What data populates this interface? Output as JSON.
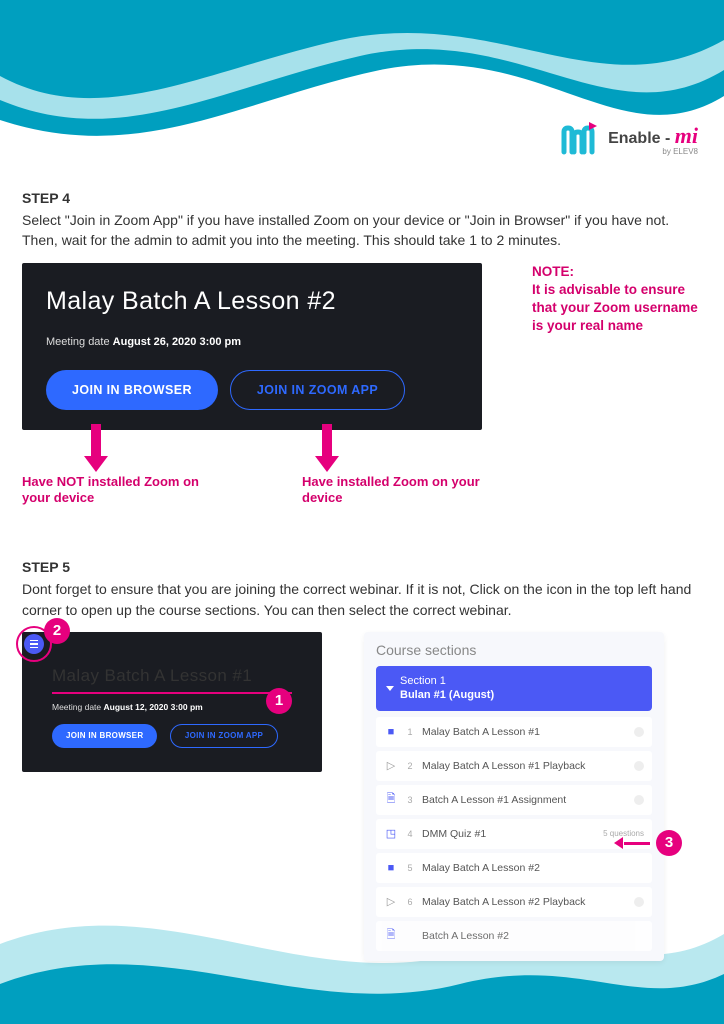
{
  "logo": {
    "brand_prefix": "Enable - ",
    "brand_mi": "mi",
    "byline": "by ELEV8"
  },
  "step4": {
    "heading": "STEP 4",
    "body_line1": "Select \"Join in Zoom App\" if you have installed Zoom on your device or \"Join in Browser\" if you have not.",
    "body_line2": "Then, wait for the admin to admit you into the meeting. This should take 1 to 2 minutes.",
    "zoom_title": "Malay Batch A Lesson #2",
    "zoom_date_label": "Meeting date ",
    "zoom_date_value": "August 26, 2020 3:00 pm",
    "btn_browser": "JOIN IN BROWSER",
    "btn_zoom_app": "JOIN IN ZOOM APP",
    "note_title": "NOTE:",
    "note_body": "It is advisable to ensure that your Zoom username is your real name",
    "annot_not_installed": "Have NOT installed Zoom on your device",
    "annot_installed": "Have installed Zoom on your device"
  },
  "step5": {
    "heading": "STEP 5",
    "body": "Dont forget to ensure that you are joining the correct webinar. If it is not, Click on the icon in the top left hand corner to open up the course sections. You can then select the correct webinar.",
    "mini_title": "Malay Batch A Lesson #1",
    "mini_date_label": "Meeting date ",
    "mini_date_value": "August 12, 2020 3:00 pm",
    "btn_browser": "JOIN IN BROWSER",
    "btn_zoom_app": "JOIN IN ZOOM APP",
    "num1": "1",
    "num2": "2",
    "num3": "3",
    "course_panel_title": "Course sections",
    "section_title_line1": "Section 1",
    "section_title_line2": "Bulan #1 (August)",
    "items": [
      {
        "icon": "video",
        "idx": "1",
        "label": "Malay Batch A Lesson #1"
      },
      {
        "icon": "play",
        "idx": "2",
        "label": "Malay Batch A Lesson #1 Playback"
      },
      {
        "icon": "doc",
        "idx": "3",
        "label": "Batch A Lesson #1 Assignment"
      },
      {
        "icon": "quiz",
        "idx": "4",
        "label": "DMM Quiz #1",
        "meta": "5 questions"
      },
      {
        "icon": "video",
        "idx": "5",
        "label": "Malay Batch A Lesson #2"
      },
      {
        "icon": "play",
        "idx": "6",
        "label": "Malay Batch A Lesson #2 Playback"
      },
      {
        "icon": "doc",
        "idx": "",
        "label": "Batch A Lesson #2"
      }
    ]
  }
}
